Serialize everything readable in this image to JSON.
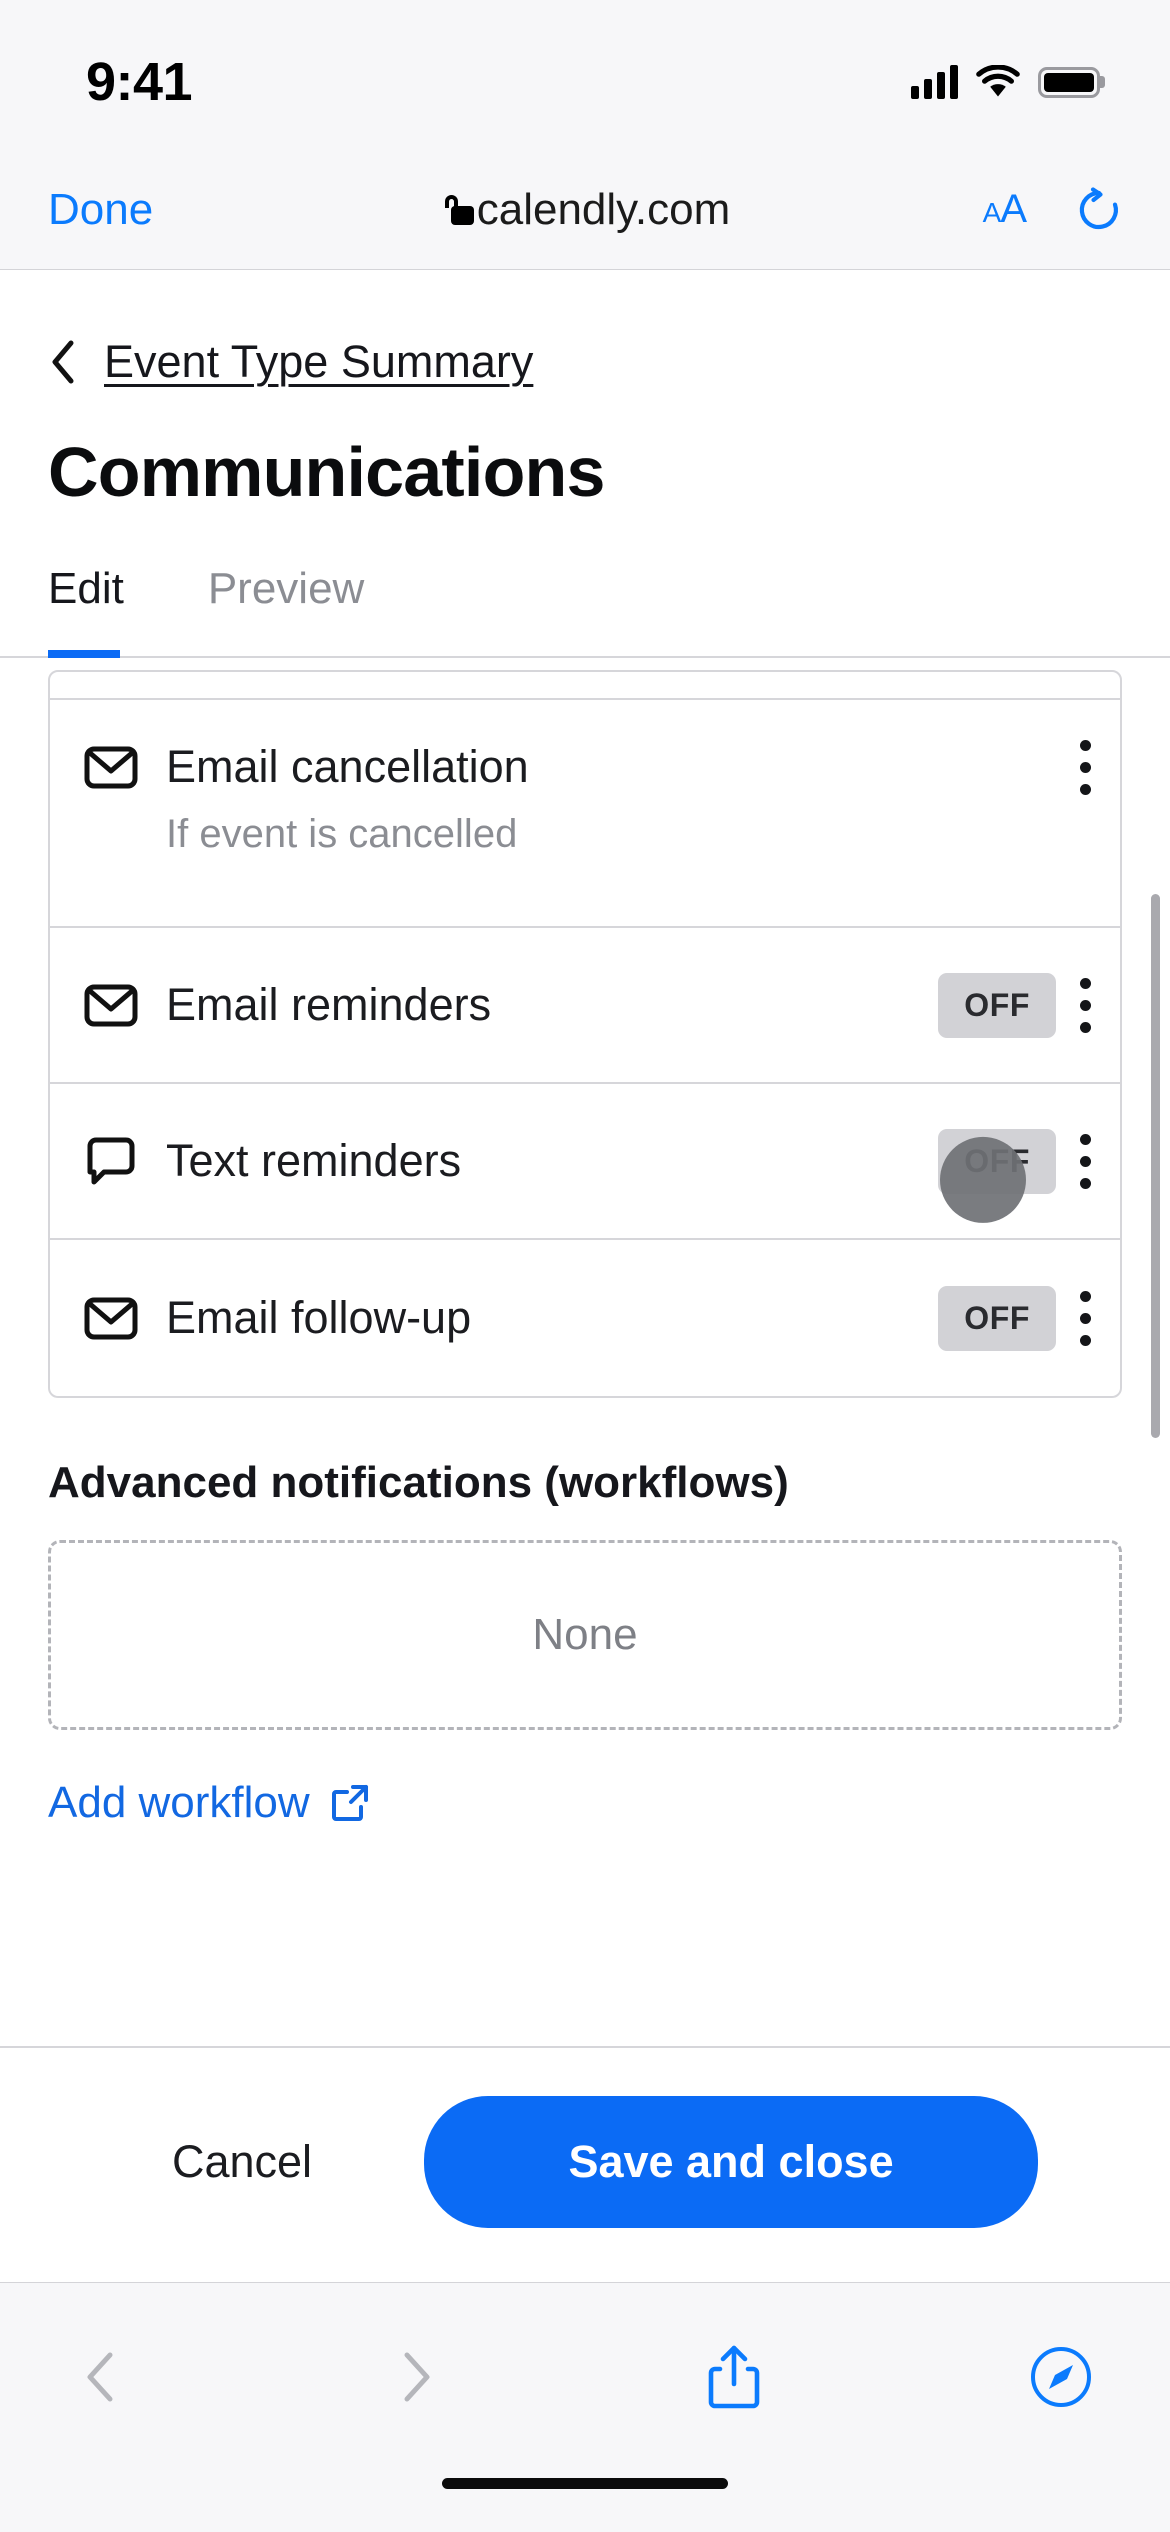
{
  "status_bar": {
    "time": "9:41",
    "signal_icon": "cellular-bars-icon",
    "wifi_icon": "wifi-icon",
    "battery_icon": "battery-full-icon"
  },
  "safari": {
    "done_label": "Done",
    "lock_icon": "lock-icon",
    "url": "calendly.com",
    "text_size_label": "AA",
    "reload_icon": "reload-icon",
    "bottom": {
      "back_icon": "chevron-left-icon",
      "forward_icon": "chevron-right-icon",
      "share_icon": "share-icon",
      "tabs_icon": "compass-icon"
    }
  },
  "page": {
    "breadcrumb": {
      "back_icon": "chevron-left-icon",
      "label": "Event Type Summary"
    },
    "title": "Communications",
    "tabs": [
      {
        "label": "Edit",
        "active": true
      },
      {
        "label": "Preview",
        "active": false
      }
    ],
    "notifications": [
      {
        "icon": "envelope-icon",
        "label": "Email cancellation",
        "sub": "If event is cancelled",
        "badge": "",
        "menu_icon": "kebab-menu-icon"
      },
      {
        "icon": "envelope-icon",
        "label": "Email reminders",
        "sub": "",
        "badge": "OFF",
        "menu_icon": "kebab-menu-icon"
      },
      {
        "icon": "chat-bubble-icon",
        "label": "Text reminders",
        "sub": "",
        "badge": "OFF",
        "menu_icon": "kebab-menu-icon"
      },
      {
        "icon": "envelope-icon",
        "label": "Email follow-up",
        "sub": "",
        "badge": "OFF",
        "menu_icon": "kebab-menu-icon"
      }
    ],
    "advanced": {
      "heading": "Advanced notifications (workflows)",
      "empty_value": "None",
      "add_link": "Add workflow",
      "add_link_icon": "external-link-icon"
    },
    "actions": {
      "cancel_label": "Cancel",
      "save_label": "Save and close"
    }
  },
  "colors": {
    "accent_blue": "#0b6bf5",
    "safari_blue": "#0b7bfd",
    "badge_gray": "#d2d2d6",
    "muted_text": "#8b8d93"
  }
}
